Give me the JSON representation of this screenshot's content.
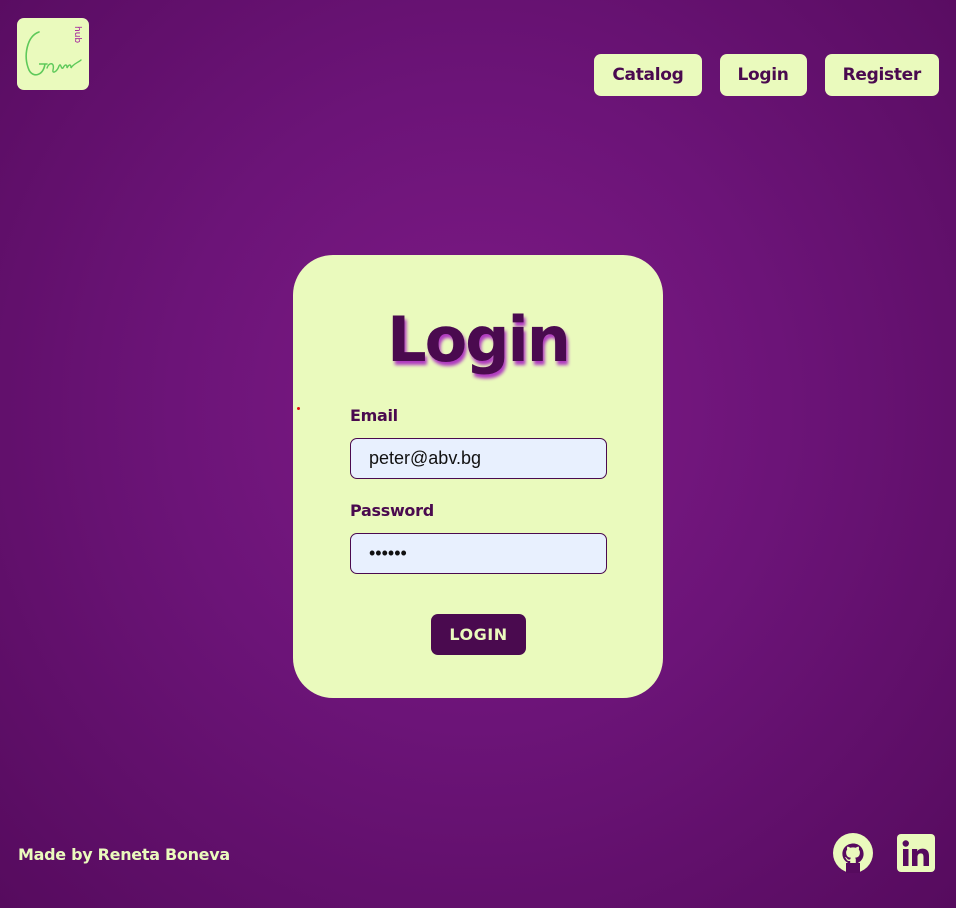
{
  "brand": {
    "logo_icon": "gamehub-logo-icon",
    "logo_text": "Game",
    "logo_subtext": "hub"
  },
  "nav": {
    "items": [
      {
        "label": "Catalog"
      },
      {
        "label": "Login"
      },
      {
        "label": "Register"
      }
    ]
  },
  "login_form": {
    "title": "Login",
    "email_label": "Email",
    "email_value": "peter@abv.bg",
    "password_label": "Password",
    "password_value": "123456",
    "submit_label": "LOGIN"
  },
  "footer": {
    "credit": "Made by Reneta Boneva",
    "github_icon": "github-icon",
    "linkedin_icon": "linkedin-icon"
  },
  "colors": {
    "background": "#6c1478",
    "card": "#eafabd",
    "primary": "#4a0a4f",
    "input_bg": "#e8f0fe"
  }
}
